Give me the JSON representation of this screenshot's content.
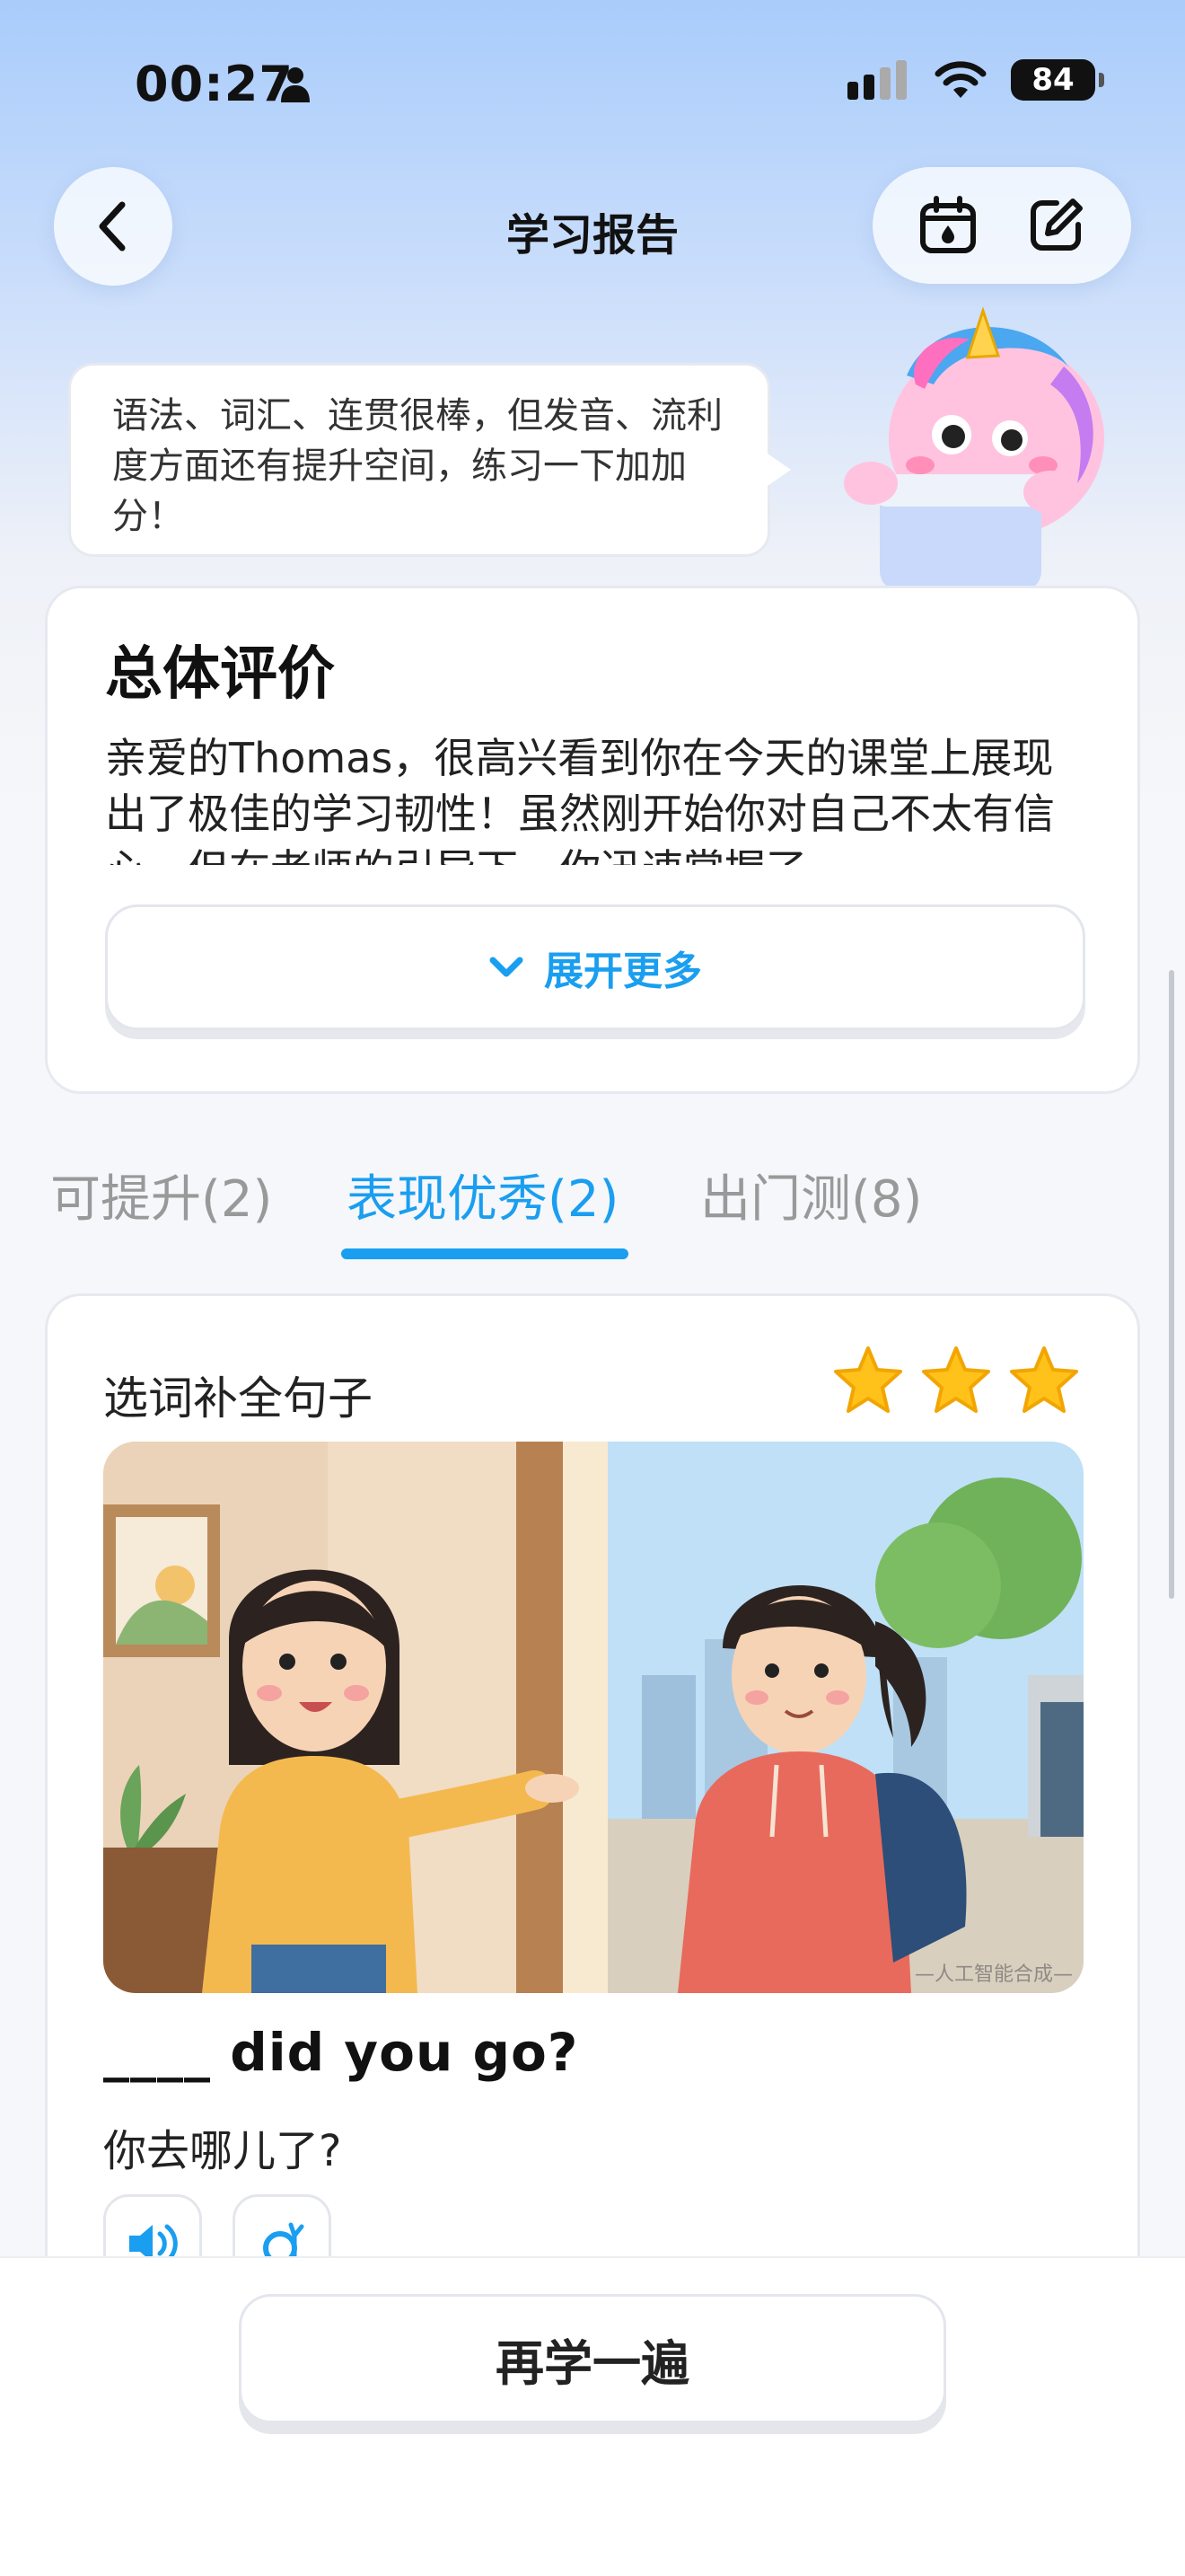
{
  "status_bar": {
    "time": "00:27",
    "battery": "84"
  },
  "nav": {
    "title": "学习报告"
  },
  "bubble": {
    "text": "语法、词汇、连贯很棒，但发音、流利度方面还有提升空间，练习一下加加分！"
  },
  "overall": {
    "title": "总体评价",
    "text": "亲爱的Thomas，很高兴看到你在今天的课堂上展现出了极佳的学习韧性！虽然刚开始你对自己不太有信心，但在老师的引导下，你迅速掌握了",
    "expand_label": "展开更多"
  },
  "tabs": [
    {
      "label": "可提升(2)",
      "active": false
    },
    {
      "label": "表现优秀(2)",
      "active": true
    },
    {
      "label": "出门测(8)",
      "active": false
    }
  ],
  "question": {
    "label": "选词补全句子",
    "stars": 3,
    "image_watermark": "—人工智能合成—",
    "sentence": "____ did you go?",
    "translation": "你去哪儿了?"
  },
  "bottom": {
    "relearn_label": "再学一遍"
  },
  "colors": {
    "accent": "#1a9ef0",
    "star": "#ffc21a"
  }
}
